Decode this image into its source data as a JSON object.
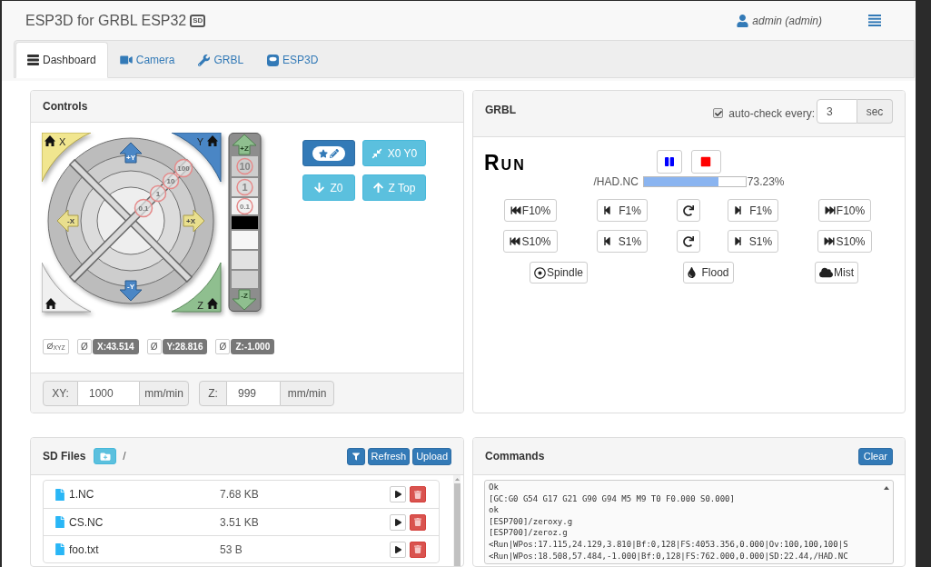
{
  "header": {
    "title": "ESP3D for GRBL ESP32",
    "badge": "SD",
    "user": "admin (admin)"
  },
  "tabs": [
    {
      "label": "Dashboard",
      "selected": true
    },
    {
      "label": "Camera",
      "selected": false
    },
    {
      "label": "GRBL",
      "selected": false
    },
    {
      "label": "ESP3D",
      "selected": false
    }
  ],
  "controls": {
    "title": "Controls",
    "jog": {
      "home_corners": [
        "X",
        "Y",
        "Z"
      ],
      "xy_arrows": [
        "+Y",
        "-X",
        "+X",
        "-Y"
      ],
      "xy_steps": [
        "100",
        "10",
        "1",
        "0.1"
      ],
      "z_arrows": [
        "+Z",
        "-Z"
      ],
      "z_steps": [
        "10",
        "1",
        "0.1"
      ]
    },
    "buttons": [
      {
        "kind": "primary"
      },
      {
        "kind": "info",
        "label": "X0 Y0"
      },
      {
        "kind": "info",
        "label": "Z0"
      },
      {
        "kind": "info",
        "label": "Z Top"
      }
    ],
    "reset_all": "Ø$_{XYZ}$",
    "positions": [
      {
        "reset": "Ø",
        "value": "X:43.514"
      },
      {
        "reset": "Ø",
        "value": "Y:28.816"
      },
      {
        "reset": "Ø",
        "value": "Z:-1.000"
      }
    ],
    "feedrates": [
      {
        "label": "XY:",
        "value": "1000",
        "unit": "mm/min"
      },
      {
        "label": "Z:",
        "value": "999",
        "unit": "mm/min"
      }
    ]
  },
  "grbl": {
    "title": "GRBL",
    "autocheck": {
      "checked": true,
      "label": "auto-check every:",
      "value": "3",
      "unit": "sec"
    },
    "state": "Run",
    "file": "/HAD.NC",
    "progress": {
      "level": 0.7323,
      "reading": "73.23%"
    },
    "overrides": [
      [
        {
          "kind": "minus10",
          "label": "F10%"
        },
        {
          "kind": "minus1",
          "label": "F1%"
        },
        {
          "kind": "reset"
        },
        {
          "kind": "plus1",
          "label": "F1%"
        },
        {
          "kind": "plus10",
          "label": "F10%"
        }
      ],
      [
        {
          "kind": "minus10",
          "label": "S10%"
        },
        {
          "kind": "minus1",
          "label": "S1%"
        },
        {
          "kind": "reset"
        },
        {
          "kind": "plus1",
          "label": "S1%"
        },
        {
          "kind": "plus10",
          "label": "S10%"
        }
      ]
    ],
    "toggles": [
      {
        "label": "Spindle"
      },
      {
        "label": "Flood"
      },
      {
        "label": "Mist"
      }
    ]
  },
  "sd_files": {
    "title": "SD Files",
    "path": "/",
    "buttons": [
      "Refresh",
      "Upload"
    ],
    "files": [
      {
        "name": "1.NC",
        "size": "7.68 KB"
      },
      {
        "name": "CS.NC",
        "size": "3.51 KB"
      },
      {
        "name": "foo.txt",
        "size": "53 B"
      }
    ]
  },
  "commands": {
    "title": "Commands",
    "button": "Clear",
    "lines": [
      "Ok",
      "[GC:G0 G54 G17 G21 G90 G94 M5 M9 T0 F0.000 S0.000]",
      "ok",
      "[ESP700]/zeroxy.g",
      "[ESP700]/zeroz.g",
      "<Run|WPos:17.115,24.129,3.810|Bf:0,128|FS:4053.356,0.000|Ov:100,100,100|S",
      "<Run|WPos:18.508,57.484,-1.000|Bf:0,128|FS:762.000,0.000|SD:22.44,/HAD.NC"
    ]
  }
}
